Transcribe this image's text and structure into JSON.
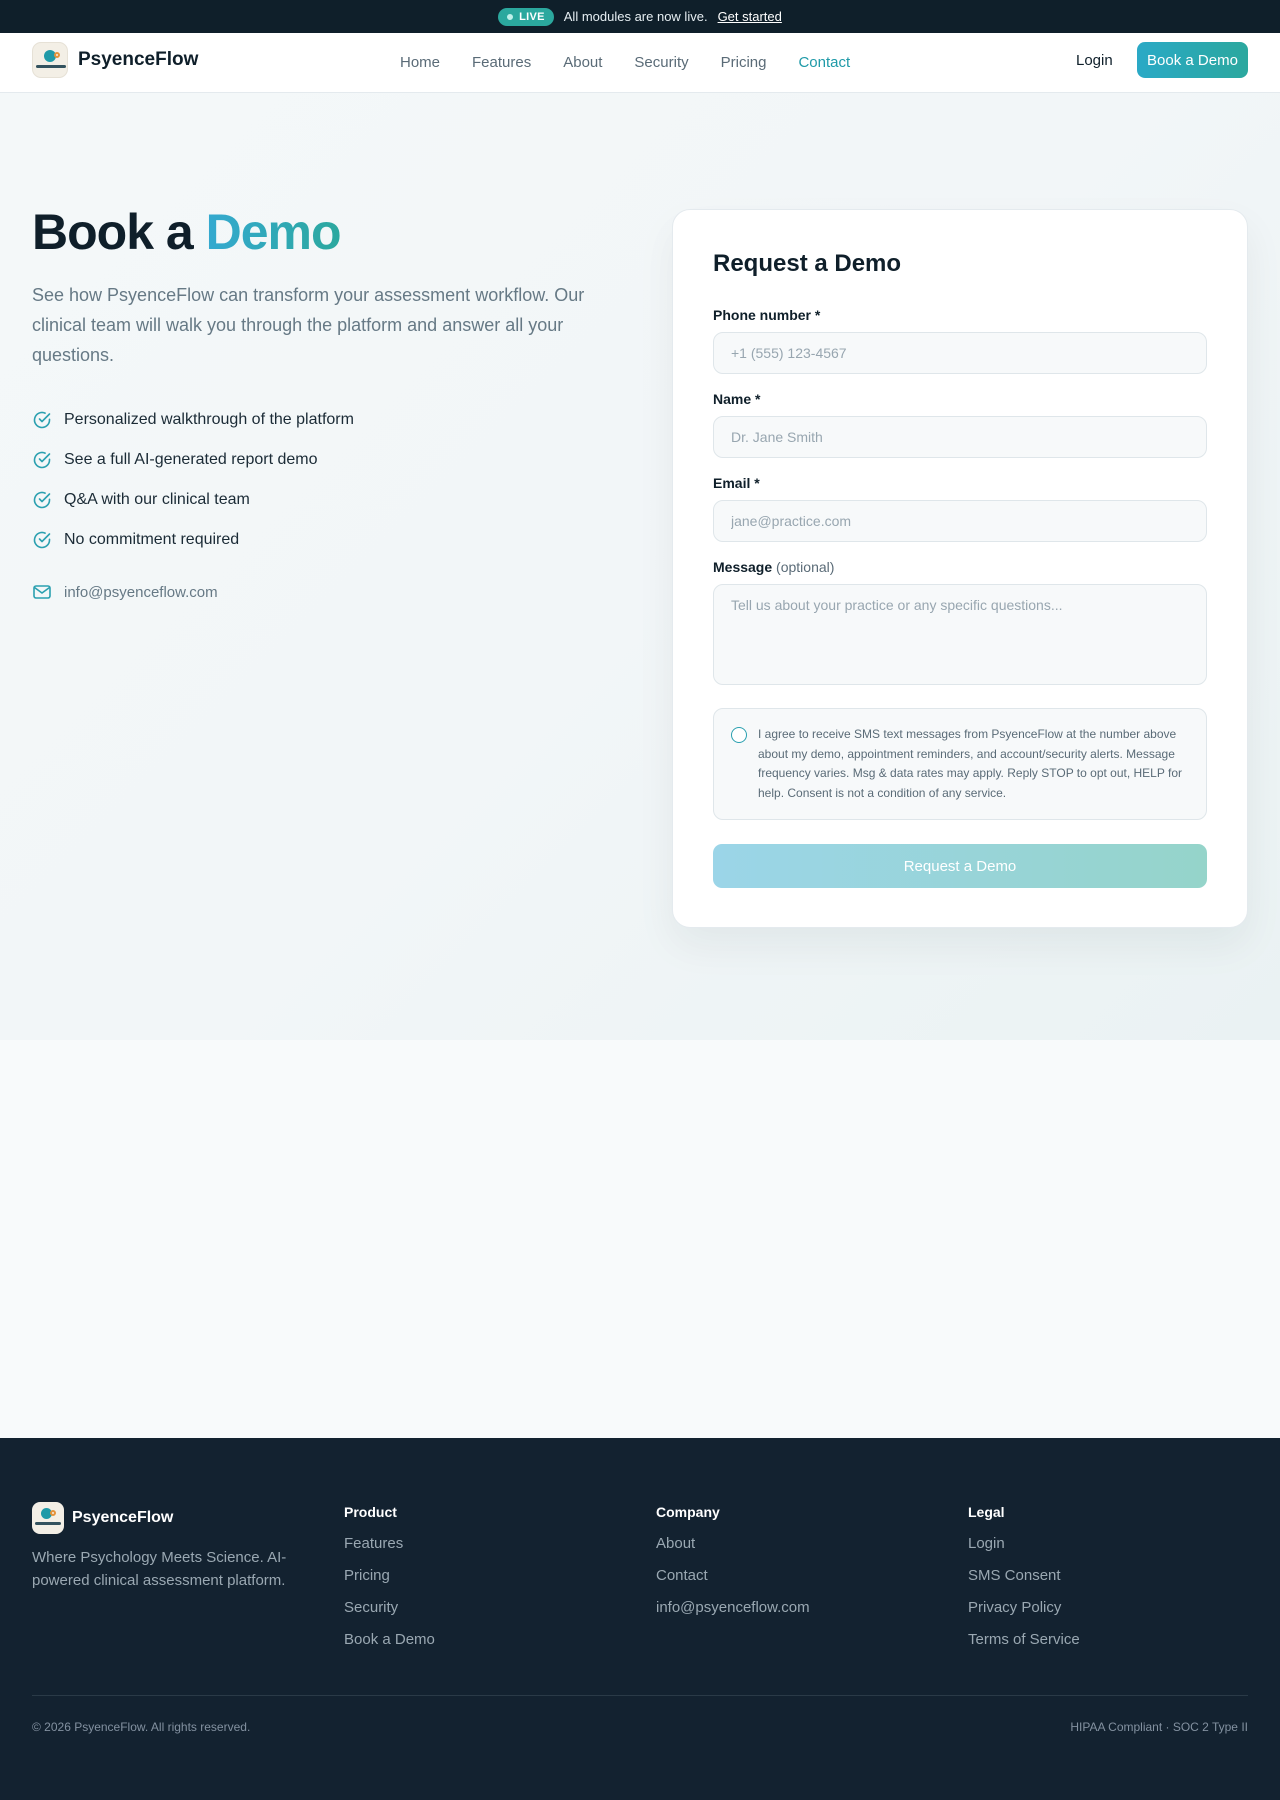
{
  "announcement": {
    "badge": "LIVE",
    "text": "All modules are now live.",
    "link": "Get started"
  },
  "nav": {
    "brand": "PsyenceFlow",
    "links": [
      "Home",
      "Features",
      "About",
      "Security",
      "Pricing",
      "Contact"
    ],
    "active": "Contact",
    "login": "Login",
    "cta": "Book a Demo"
  },
  "hero": {
    "title_prefix": "Book a",
    "title_accent": "Demo",
    "subtitle": "See how PsyenceFlow can transform your assessment workflow. Our clinical team will walk you through the platform and answer all your questions.",
    "benefits": [
      "Personalized walkthrough of the platform",
      "See a full AI-generated report demo",
      "Q&A with our clinical team",
      "No commitment required"
    ],
    "email": "info@psyenceflow.com"
  },
  "form": {
    "title": "Request a Demo",
    "phone": {
      "label": "Phone number *",
      "placeholder": "+1 (555) 123-4567",
      "value": ""
    },
    "name": {
      "label": "Name *",
      "placeholder": "Dr. Jane Smith",
      "value": ""
    },
    "email": {
      "label": "Email *",
      "placeholder": "jane@practice.com",
      "value": ""
    },
    "message": {
      "label": "Message",
      "optional": "(optional)",
      "placeholder": "Tell us about your practice or any specific questions...",
      "value": ""
    },
    "consent": "I agree to receive SMS text messages from PsyenceFlow at the number above about my demo, appointment reminders, and account/security alerts. Message frequency varies. Msg & data rates may apply. Reply STOP to opt out, HELP for help. Consent is not a condition of any service.",
    "consent_checked": false,
    "submit": "Request a Demo"
  },
  "footer": {
    "brand": "PsyenceFlow",
    "tagline": "Where Psychology Meets Science. AI-powered clinical assessment platform.",
    "columns": [
      {
        "title": "Product",
        "links": [
          "Features",
          "Pricing",
          "Security",
          "Book a Demo"
        ]
      },
      {
        "title": "Company",
        "links": [
          "About",
          "Contact",
          "info@psyenceflow.com"
        ]
      },
      {
        "title": "Legal",
        "links": [
          "Login",
          "SMS Consent",
          "Privacy Policy",
          "Terms of Service"
        ]
      }
    ],
    "copyright": "© 2026 PsyenceFlow. All rights reserved.",
    "compliance": "HIPAA Compliant · SOC 2 Type II"
  },
  "colors": {
    "accent": "#2ba89e",
    "accent_blue": "#2aa9c6",
    "dark": "#0f1f2a",
    "footer_bg": "#132230"
  },
  "icons": {
    "benefit": "check-circle-icon",
    "email": "mail-icon",
    "live": "dot-icon"
  }
}
